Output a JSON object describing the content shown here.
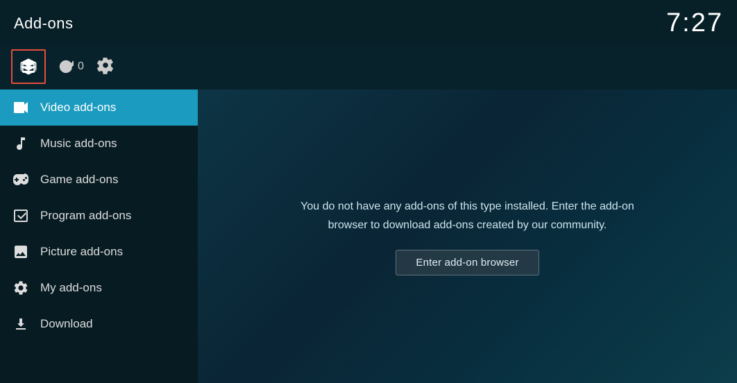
{
  "header": {
    "title": "Add-ons",
    "time": "7:27"
  },
  "toolbar": {
    "refresh_count": "0",
    "box_icon": "addon-box-icon",
    "refresh_icon": "refresh-icon",
    "settings_icon": "settings-icon"
  },
  "sidebar": {
    "items": [
      {
        "id": "video-addons",
        "label": "Video add-ons",
        "icon": "video-icon",
        "active": true
      },
      {
        "id": "music-addons",
        "label": "Music add-ons",
        "icon": "music-icon",
        "active": false
      },
      {
        "id": "game-addons",
        "label": "Game add-ons",
        "icon": "game-icon",
        "active": false
      },
      {
        "id": "program-addons",
        "label": "Program add-ons",
        "icon": "program-icon",
        "active": false
      },
      {
        "id": "picture-addons",
        "label": "Picture add-ons",
        "icon": "picture-icon",
        "active": false
      },
      {
        "id": "my-addons",
        "label": "My add-ons",
        "icon": "myaddon-icon",
        "active": false
      },
      {
        "id": "download",
        "label": "Download",
        "icon": "download-icon",
        "active": false
      }
    ]
  },
  "content": {
    "message": "You do not have any add-ons of this type installed. Enter the add-on browser to download add-ons created by our community.",
    "enter_browser_label": "Enter add-on browser"
  }
}
